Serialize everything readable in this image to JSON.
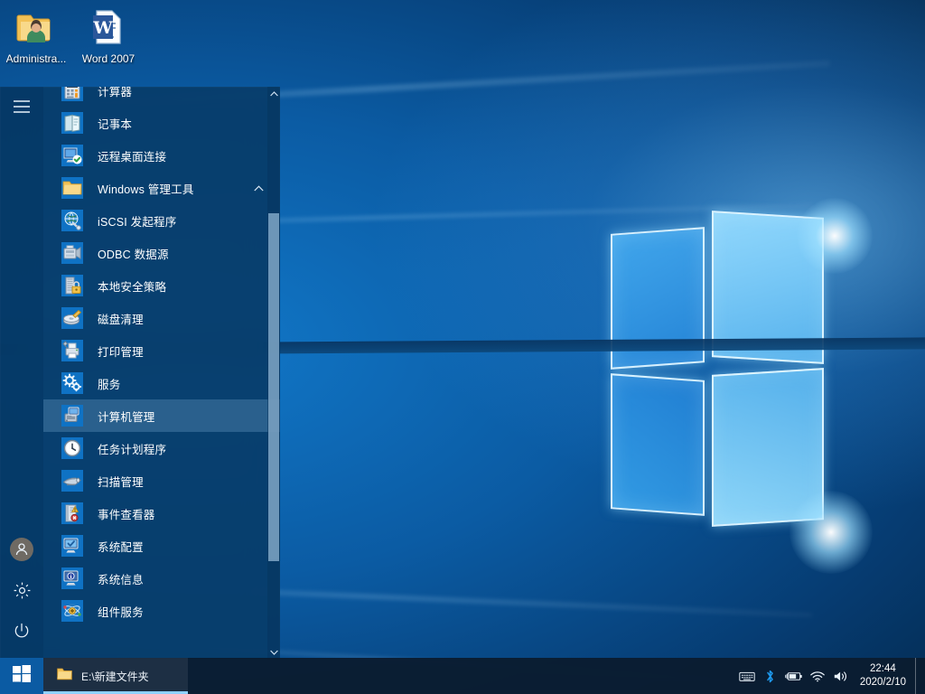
{
  "desktop": {
    "icons": [
      {
        "name": "administrator-folder",
        "label": "Administra...",
        "icon": "user-folder-icon"
      },
      {
        "name": "word-2007",
        "label": "Word 2007",
        "icon": "word-document-icon"
      }
    ],
    "wallpaper": "windows-10-hero-logo"
  },
  "colors": {
    "accent": "#0b5ba3",
    "start_menu_bg": "#073c69",
    "taskbar_bg": "#0a1c30",
    "tile_blue": "#0f72c4",
    "selection": "#70a0c8",
    "text": "#ffffff"
  },
  "start_menu": {
    "rail": [
      {
        "name": "hamburger",
        "icon": "hamburger-menu-icon",
        "label": ""
      },
      {
        "name": "user",
        "icon": "user-account-icon",
        "label": ""
      },
      {
        "name": "settings",
        "icon": "gear-icon",
        "label": ""
      },
      {
        "name": "power",
        "icon": "power-icon",
        "label": ""
      }
    ],
    "apps": [
      {
        "label": "计算器",
        "icon": "calculator-icon",
        "type": "app",
        "selected": false
      },
      {
        "label": "记事本",
        "icon": "notepad-icon",
        "type": "app",
        "selected": false
      },
      {
        "label": "远程桌面连接",
        "icon": "remote-desktop-icon",
        "type": "app",
        "selected": false
      },
      {
        "label": "Windows 管理工具",
        "icon": "folder-icon",
        "type": "group",
        "expanded": true,
        "selected": false
      },
      {
        "label": "iSCSI 发起程序",
        "icon": "iscsi-icon",
        "type": "app",
        "selected": false
      },
      {
        "label": "ODBC 数据源",
        "icon": "odbc-icon",
        "type": "app",
        "selected": false
      },
      {
        "label": "本地安全策略",
        "icon": "security-policy-icon",
        "type": "app",
        "selected": false
      },
      {
        "label": "磁盘清理",
        "icon": "disk-cleanup-icon",
        "type": "app",
        "selected": false
      },
      {
        "label": "打印管理",
        "icon": "print-management-icon",
        "type": "app",
        "selected": false
      },
      {
        "label": "服务",
        "icon": "services-gears-icon",
        "type": "app",
        "selected": false
      },
      {
        "label": "计算机管理",
        "icon": "computer-management-icon",
        "type": "app",
        "selected": true
      },
      {
        "label": "任务计划程序",
        "icon": "task-scheduler-clock-icon",
        "type": "app",
        "selected": false
      },
      {
        "label": "扫描管理",
        "icon": "scan-management-icon",
        "type": "app",
        "selected": false
      },
      {
        "label": "事件查看器",
        "icon": "event-viewer-icon",
        "type": "app",
        "selected": false
      },
      {
        "label": "系统配置",
        "icon": "system-configuration-icon",
        "type": "app",
        "selected": false
      },
      {
        "label": "系统信息",
        "icon": "system-information-icon",
        "type": "app",
        "selected": false
      },
      {
        "label": "组件服务",
        "icon": "component-services-icon",
        "type": "app",
        "selected": false
      }
    ],
    "scrollbar": {
      "up_arrow": "chevron-up-icon",
      "down_arrow": "chevron-down-icon"
    },
    "group_chevron": "chevron-up-icon"
  },
  "taskbar": {
    "start_button": {
      "name": "start-button",
      "icon": "windows-logo-icon"
    },
    "tasks": [
      {
        "label": "E:\\新建文件夹",
        "icon": "folder-icon",
        "active": true
      }
    ],
    "tray": [
      {
        "name": "touch-keyboard",
        "icon": "keyboard-icon"
      },
      {
        "name": "bluetooth",
        "icon": "bluetooth-icon"
      },
      {
        "name": "battery",
        "icon": "battery-charging-icon"
      },
      {
        "name": "network",
        "icon": "wifi-icon"
      },
      {
        "name": "volume",
        "icon": "speaker-icon"
      }
    ],
    "clock": {
      "time": "22:44",
      "date": "2020/2/10"
    }
  }
}
